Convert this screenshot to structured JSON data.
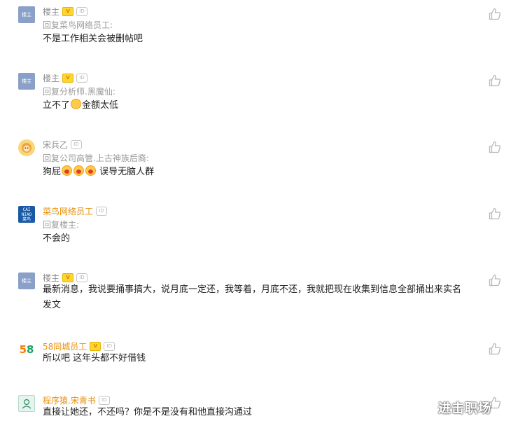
{
  "comments": [
    {
      "user": "楼主",
      "reply_to": "回复菜鸟网络员工:",
      "text": "不是工作相关会被删帖吧",
      "avatar_text": "楼主",
      "has_v": true
    },
    {
      "user": "楼主",
      "reply_to": "回复分析师.黑魔仙:",
      "text_before": "立不了",
      "text_after": "金额太低",
      "avatar_text": "楼主",
      "has_v": true
    },
    {
      "user": "宋兵乙",
      "reply_to": "回复公司高管.上古神族后裔:",
      "text_before": "狗屁",
      "text_after": " 误导无脑人群",
      "has_v": false
    },
    {
      "user": "菜鸟网络员工",
      "reply_to": "回复楼主:",
      "text": "不会的",
      "avatar_lines": [
        "CAI",
        "NIAO",
        "菜鸟"
      ],
      "has_v": false
    },
    {
      "user": "楼主",
      "text": "最新消息，我说要捅事搞大，说月底一定还，我等着，月底不还，我就把现在收集到信息全部捅出来实名发文",
      "avatar_text": "楼主",
      "has_v": true
    },
    {
      "user": "58同城员工",
      "text": "所以吧 这年头都不好借钱",
      "has_v": true
    },
    {
      "user": "程序猿.宋青书",
      "text": "直接让她还，不还吗？你是不是没有和他直接沟通过",
      "has_v": false
    }
  ],
  "badges": {
    "v": "V",
    "id": "ID"
  },
  "icons": {
    "like": "thumbs-up-icon"
  },
  "colors": {
    "orange_name": "#e8900c",
    "gray_name": "#8c8c8c"
  },
  "watermark": "进击职场"
}
